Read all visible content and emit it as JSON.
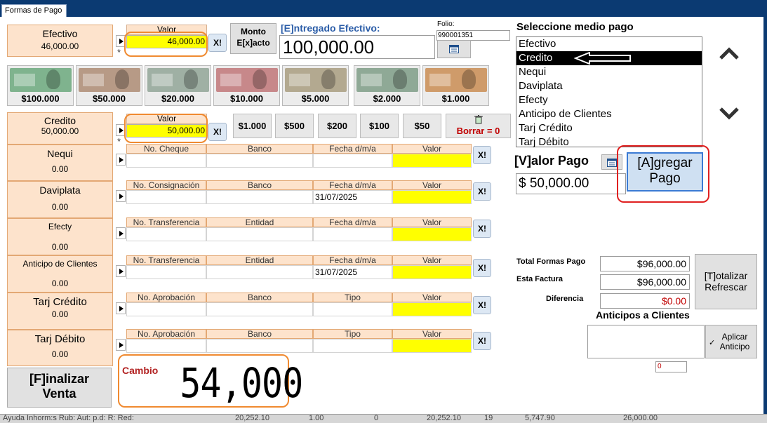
{
  "window": {
    "tab_title": "Formas de Pago"
  },
  "methods": [
    {
      "label": "Efectivo",
      "value": "46,000.00"
    },
    {
      "label": "Credito",
      "value": "50,000.00"
    },
    {
      "label": "Nequi",
      "value": "0.00"
    },
    {
      "label": "Daviplata",
      "value": "0.00"
    },
    {
      "label": "Efecty",
      "value": "0.00"
    },
    {
      "label": "Anticipo de Clientes",
      "value": "0.00"
    },
    {
      "label": "Tarj Crédito",
      "value": "0.00"
    },
    {
      "label": "Tarj Débito",
      "value": "0.00"
    }
  ],
  "efectivo": {
    "valor_header": "Valor",
    "valor": "46,000.00",
    "star": "*"
  },
  "credito": {
    "valor_header": "Valor",
    "valor": "50,000.00",
    "star": "*"
  },
  "monto_exacto": {
    "line1": "Monto",
    "line2": "E[x]acto"
  },
  "entregado": {
    "label": "[E]ntregado Efectivo:",
    "value": "100,000.00"
  },
  "folio": {
    "label": "Folio:",
    "value": "990001351"
  },
  "bills": [
    {
      "label": "$100.000",
      "color": "#7fb38e"
    },
    {
      "label": "$50.000",
      "color": "#b79a86"
    },
    {
      "label": "$20.000",
      "color": "#9fb0a4"
    },
    {
      "label": "$10.000",
      "color": "#c7888a"
    },
    {
      "label": "$5.000",
      "color": "#b3a990"
    },
    {
      "label": "$2.000",
      "color": "#8fa996"
    },
    {
      "label": "$1.000",
      "color": "#cf9b6a"
    }
  ],
  "coins": [
    "$1.000",
    "$500",
    "$200",
    "$100",
    "$50"
  ],
  "borrar": {
    "icon": "recycle-bin-icon",
    "label": "Borrar = 0"
  },
  "x_label": "X!",
  "grids": [
    {
      "headers": [
        "No. Cheque",
        "Banco",
        "Fecha d/m/a",
        "Valor"
      ],
      "fecha": ""
    },
    {
      "headers": [
        "No. Consignación",
        "Banco",
        "Fecha d/m/a",
        "Valor"
      ],
      "fecha": "31/07/2025"
    },
    {
      "headers": [
        "No. Transferencia",
        "Entidad",
        "Fecha d/m/a",
        "Valor"
      ],
      "fecha": ""
    },
    {
      "headers": [
        "No. Transferencia",
        "Entidad",
        "Fecha d/m/a",
        "Valor"
      ],
      "fecha": "31/07/2025"
    },
    {
      "headers": [
        "No. Aprobación",
        "Banco",
        "Tipo",
        "Valor"
      ],
      "fecha": ""
    },
    {
      "headers": [
        "No. Aprobación",
        "Banco",
        "Tipo",
        "Valor"
      ],
      "fecha": ""
    }
  ],
  "medio_pago": {
    "title": "Seleccione medio pago",
    "options": [
      "Efectivo",
      "Credito",
      "Nequi",
      "Daviplata",
      "Efecty",
      "Anticipo de Clientes",
      "Tarj Crédito",
      "Tarj Débito"
    ],
    "selected": "Credito"
  },
  "valor_pago": {
    "label": "[V]alor Pago",
    "value": "$ 50,000.00"
  },
  "agregar": {
    "line1": "[A]gregar",
    "line2": "Pago"
  },
  "totals": {
    "total_label": "Total Formas Pago",
    "total": "$96,000.00",
    "factura_label": "Esta Factura",
    "factura": "$96,000.00",
    "diferencia_label": "Diferencia",
    "diferencia": "$0.00"
  },
  "totalizar": {
    "line1": "[T]otalizar",
    "line2": "Refrescar"
  },
  "anticipos": {
    "title": "Anticipos a Clientes",
    "aplicar1": "Aplicar",
    "aplicar2": "Anticipo",
    "counter": "0"
  },
  "finalizar": {
    "line1": "[F]inalizar",
    "line2": "Venta"
  },
  "cambio": {
    "label": "Cambio",
    "value": "54,000"
  },
  "statusbar": [
    "Ayuda Inhorm:s Rub: Aut: p.d: R: Red:",
    "20,252.10",
    "1.00",
    "0",
    "20,252.10",
    "19",
    "5,747.90",
    "26,000.00"
  ],
  "colors": {
    "titlebar": "#0b3a72",
    "peach": "#fde3cc",
    "yellow": "#ffff00",
    "orange": "#f08a30",
    "red": "#e02020",
    "negative": "#c00000"
  }
}
